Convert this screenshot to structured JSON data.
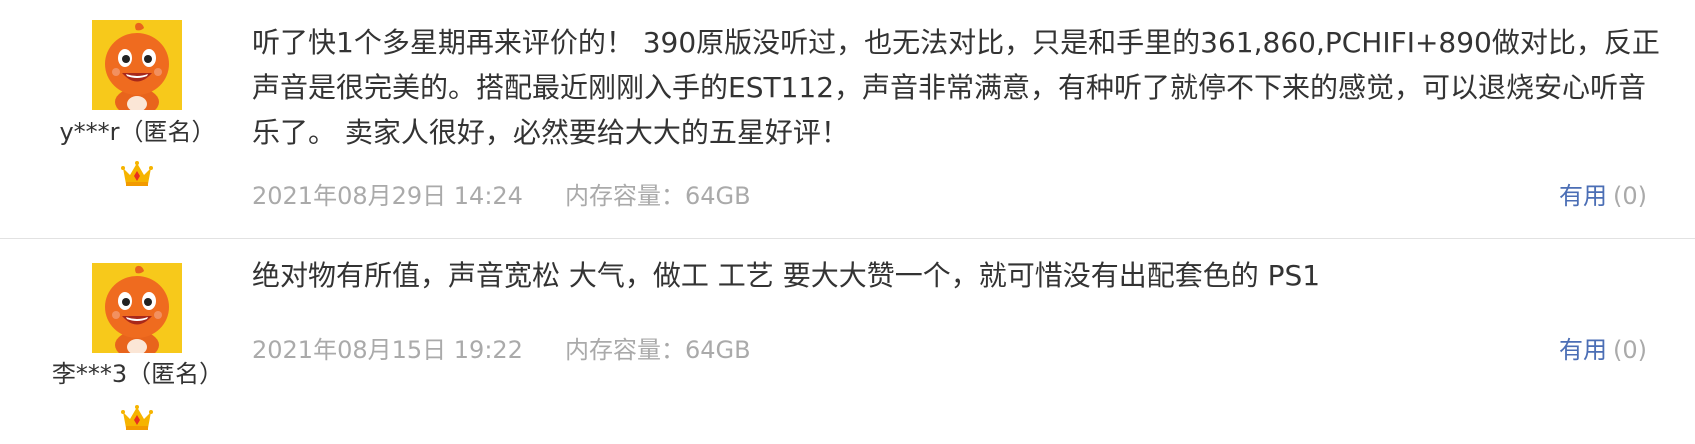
{
  "reviews": [
    {
      "username": "y***r（匿名）",
      "content": "听了快1个多星期再来评价的！ 390原版没听过，也无法对比，只是和手里的361,860,PCHIFI+890做对比，反正声音是很完美的。搭配最近刚刚入手的EST112，声音非常满意，有种听了就停不下来的感觉，可以退烧安心听音乐了。 卖家人很好，必然要给大大的五星好评！",
      "date": "2021年08月29日 14:24",
      "spec": "内存容量：64GB",
      "useful_label": "有用",
      "useful_count": "(0)"
    },
    {
      "username": "李***3（匿名）",
      "content": "绝对物有所值，声音宽松 大气，做工 工艺 要大大赞一个，就可惜没有出配套色的 PS1",
      "date": "2021年08月15日 19:22",
      "spec": "内存容量：64GB",
      "useful_label": "有用",
      "useful_count": "(0)"
    }
  ]
}
